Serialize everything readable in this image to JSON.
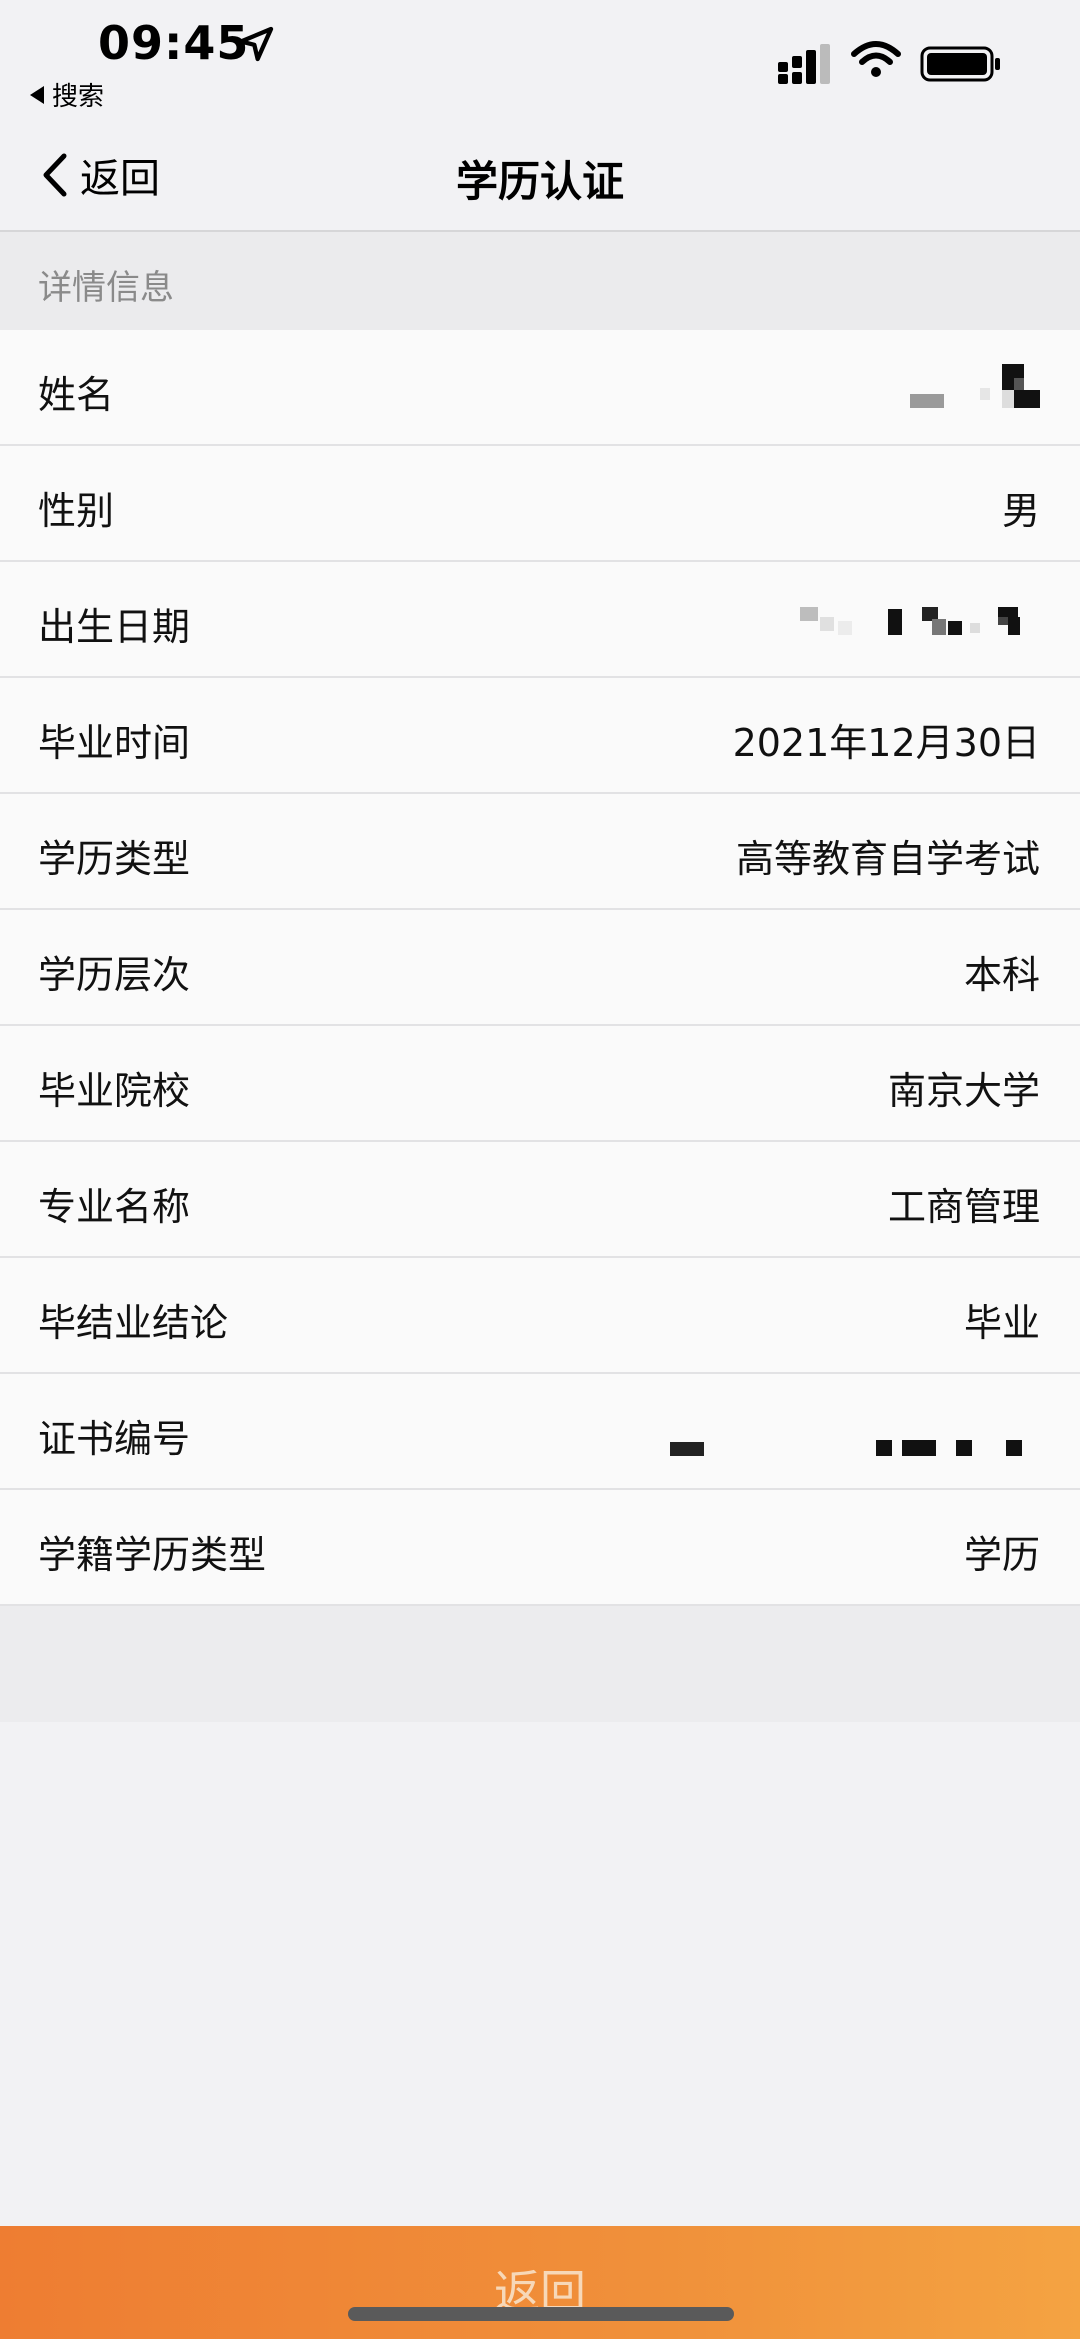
{
  "status_bar": {
    "time": "09:45",
    "back_app_label": "搜索",
    "icons": [
      "location-arrow-icon",
      "cellular-signal-icon",
      "wifi-icon",
      "battery-icon"
    ]
  },
  "nav": {
    "back_label": "返回",
    "title": "学历认证"
  },
  "section": {
    "title": "详情信息"
  },
  "rows": [
    {
      "label": "姓名",
      "value": ""
    },
    {
      "label": "性别",
      "value": "男"
    },
    {
      "label": "出生日期",
      "value": ""
    },
    {
      "label": "毕业时间",
      "value": "2021年12月30日"
    },
    {
      "label": "学历类型",
      "value": "高等教育自学考试"
    },
    {
      "label": "学历层次",
      "value": "本科"
    },
    {
      "label": "毕业院校",
      "value": "南京大学"
    },
    {
      "label": "专业名称",
      "value": "工商管理"
    },
    {
      "label": "毕结业结论",
      "value": "毕业"
    },
    {
      "label": "证书编号",
      "value": ""
    },
    {
      "label": "学籍学历类型",
      "value": "学历"
    }
  ],
  "footer": {
    "button_label": "返回"
  },
  "colors": {
    "accent_orange": "#ee7d32",
    "background": "#f2f2f4",
    "row_background": "#fafafa"
  }
}
